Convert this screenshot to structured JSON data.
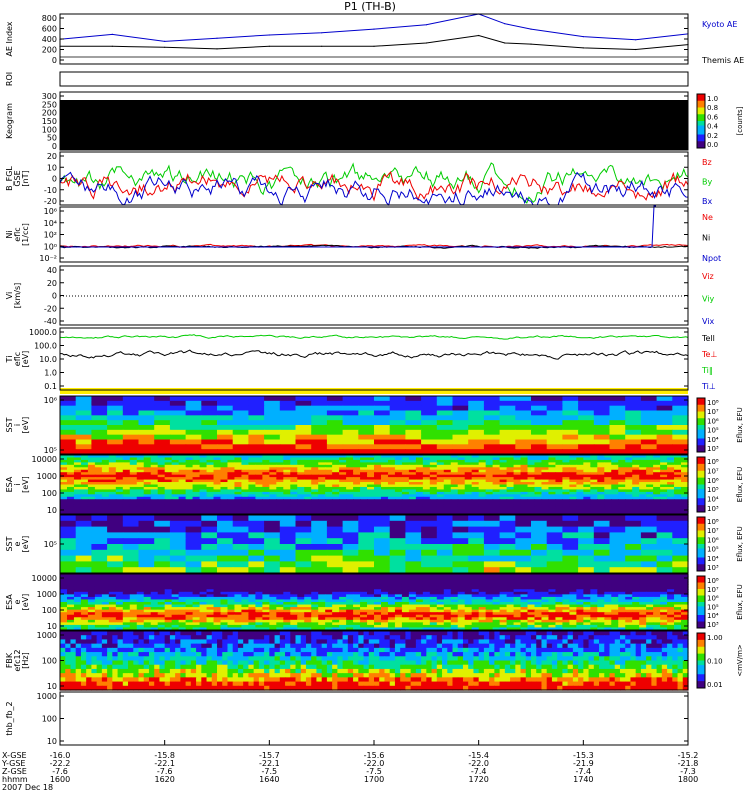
{
  "title": "P1  (TH-B)",
  "colors": {
    "kyoto": "#0000cc",
    "themis": "#000000",
    "red": "#ee0000",
    "green": "#00cc00",
    "blue": "#0000cc",
    "yellow": "#ffee00"
  },
  "panels": [
    {
      "id": "ae",
      "ylabel": [
        "AE Index"
      ],
      "ticks": [
        "800",
        "600",
        "400",
        "200",
        "0"
      ],
      "right": [
        {
          "text": "Kyoto AE",
          "color": "kyoto"
        },
        {
          "text": "Themis AE",
          "color": "themis"
        }
      ]
    },
    {
      "id": "roi",
      "ylabel": [
        "ROI"
      ],
      "ticks": [],
      "right": []
    },
    {
      "id": "keo",
      "ylabel": [
        "Keogram"
      ],
      "ticks": [
        "300",
        "250",
        "200",
        "150",
        "100",
        "50",
        "0"
      ],
      "right": [],
      "cbar": {
        "ticks": [
          "1.0",
          "0.8",
          "0.6",
          "0.4",
          "0.2",
          "0.0"
        ],
        "label": "[counts]"
      }
    },
    {
      "id": "bfgl",
      "ylabel": [
        "B_FGL",
        "GSE",
        "[nT]"
      ],
      "ticks": [
        "20",
        "10",
        "0",
        "-10",
        "-20"
      ],
      "right": [
        {
          "text": "Bz",
          "color": "red"
        },
        {
          "text": "By",
          "color": "green"
        },
        {
          "text": "Bx",
          "color": "blue"
        }
      ]
    },
    {
      "id": "ni",
      "ylabel": [
        "Ni",
        "eflc",
        "[1/cc]"
      ],
      "ticks": [
        "10⁶",
        "10⁴",
        "10²",
        "10⁰",
        "10⁻²"
      ],
      "right": [
        {
          "text": "Ne",
          "color": "red"
        },
        {
          "text": "Ni",
          "color": "themis"
        },
        {
          "text": "Npot",
          "color": "blue"
        }
      ]
    },
    {
      "id": "vi",
      "ylabel": [
        "Vi",
        "[km/s]"
      ],
      "ticks": [
        "40",
        "20",
        "0",
        "-20",
        "-40"
      ],
      "right": [
        {
          "text": "Viz",
          "color": "red"
        },
        {
          "text": "Viy",
          "color": "green"
        },
        {
          "text": "Vix",
          "color": "blue"
        }
      ]
    },
    {
      "id": "ti",
      "ylabel": [
        "Ti",
        "eflc",
        "[eV]"
      ],
      "ticks": [
        "1000.0",
        "100.0",
        "10.0",
        "1.0",
        "0.1"
      ],
      "right": [
        {
          "text": "Tell",
          "color": "themis"
        },
        {
          "text": "Te⊥",
          "color": "red"
        },
        {
          "text": "Ti‖",
          "color": "green"
        },
        {
          "text": "Ti⊥",
          "color": "blue"
        }
      ]
    },
    {
      "id": "sst1",
      "ylabel": [
        "SST",
        "i",
        "[eV]"
      ],
      "ticks": [
        "10⁶",
        "10⁵"
      ],
      "right": [],
      "cbar": {
        "ticks": [
          "10⁸",
          "10⁷",
          "10⁶",
          "10⁵",
          "10⁴",
          "10³"
        ],
        "label": "Eflux, EFU"
      }
    },
    {
      "id": "esa1",
      "ylabel": [
        "ESA",
        "i",
        "[eV]"
      ],
      "ticks": [
        "10000",
        "1000",
        "100",
        "10"
      ],
      "right": [],
      "cbar": {
        "ticks": [
          "10⁸",
          "10⁷",
          "10⁶",
          "10⁵",
          "10⁴",
          "10³"
        ],
        "label": "Eflux, EFU"
      }
    },
    {
      "id": "sst2",
      "ylabel": [
        "SST",
        "e",
        "[eV]"
      ],
      "ticks": [
        "10⁵"
      ],
      "right": [],
      "cbar": {
        "ticks": [
          "10⁸",
          "10⁷",
          "10⁶",
          "10⁵",
          "10⁴",
          "10³"
        ],
        "label": "Eflux, EFU"
      }
    },
    {
      "id": "esa2",
      "ylabel": [
        "ESA",
        "e",
        "[eV]"
      ],
      "ticks": [
        "10000",
        "1000",
        "100",
        "10"
      ],
      "right": [],
      "cbar": {
        "ticks": [
          "10⁸",
          "10⁷",
          "10⁶",
          "10⁵",
          "10⁴",
          "10³"
        ],
        "label": "Eflux, EFU"
      }
    },
    {
      "id": "fbk",
      "ylabel": [
        "FBK",
        "efc12",
        "[Hz]"
      ],
      "ticks": [
        "1000",
        "100",
        "10"
      ],
      "right": [],
      "cbar": {
        "ticks": [
          "1.00",
          "0.10",
          "0.01"
        ],
        "label": "<mV/m>"
      }
    },
    {
      "id": "fb2",
      "ylabel": [
        "thb_fb_2"
      ],
      "ticks": [
        "1000",
        "100",
        "10"
      ],
      "right": []
    }
  ],
  "chart_data": {
    "type": "line",
    "x_axis": {
      "row_labels": [
        "X-GSE",
        "Y-GSE",
        "Z-GSE",
        "hhmm",
        "2007 Dec 18"
      ],
      "ticks": [
        {
          "hhmm": "1600",
          "x": "-16.0",
          "y": "-22.2",
          "z": "-7.6"
        },
        {
          "hhmm": "1620",
          "x": "-15.8",
          "y": "-22.1",
          "z": "-7.6"
        },
        {
          "hhmm": "1640",
          "x": "-15.7",
          "y": "-22.1",
          "z": "-7.5"
        },
        {
          "hhmm": "1700",
          "x": "-15.6",
          "y": "-22.0",
          "z": "-7.5"
        },
        {
          "hhmm": "1720",
          "x": "-15.4",
          "y": "-22.0",
          "z": "-7.4"
        },
        {
          "hhmm": "1740",
          "x": "-15.3",
          "y": "-21.9",
          "z": "-7.4"
        },
        {
          "hhmm": "1800",
          "x": "-15.2",
          "y": "-21.8",
          "z": "-7.3"
        }
      ]
    },
    "series": [
      {
        "panel": "ae",
        "name": "Kyoto AE",
        "x_hhmm": [
          "1600",
          "1610",
          "1620",
          "1630",
          "1640",
          "1650",
          "1700",
          "1710",
          "1720",
          "1725",
          "1730",
          "1740",
          "1750",
          "1800"
        ],
        "values": [
          330,
          420,
          290,
          350,
          410,
          450,
          520,
          600,
          800,
          620,
          520,
          380,
          320,
          430
        ]
      },
      {
        "panel": "ae",
        "name": "Themis AE",
        "x_hhmm": [
          "1600",
          "1610",
          "1620",
          "1630",
          "1640",
          "1650",
          "1700",
          "1710",
          "1720",
          "1725",
          "1730",
          "1740",
          "1750",
          "1800"
        ],
        "values": [
          200,
          200,
          180,
          150,
          200,
          200,
          200,
          260,
          400,
          260,
          240,
          170,
          140,
          230
        ]
      }
    ]
  }
}
